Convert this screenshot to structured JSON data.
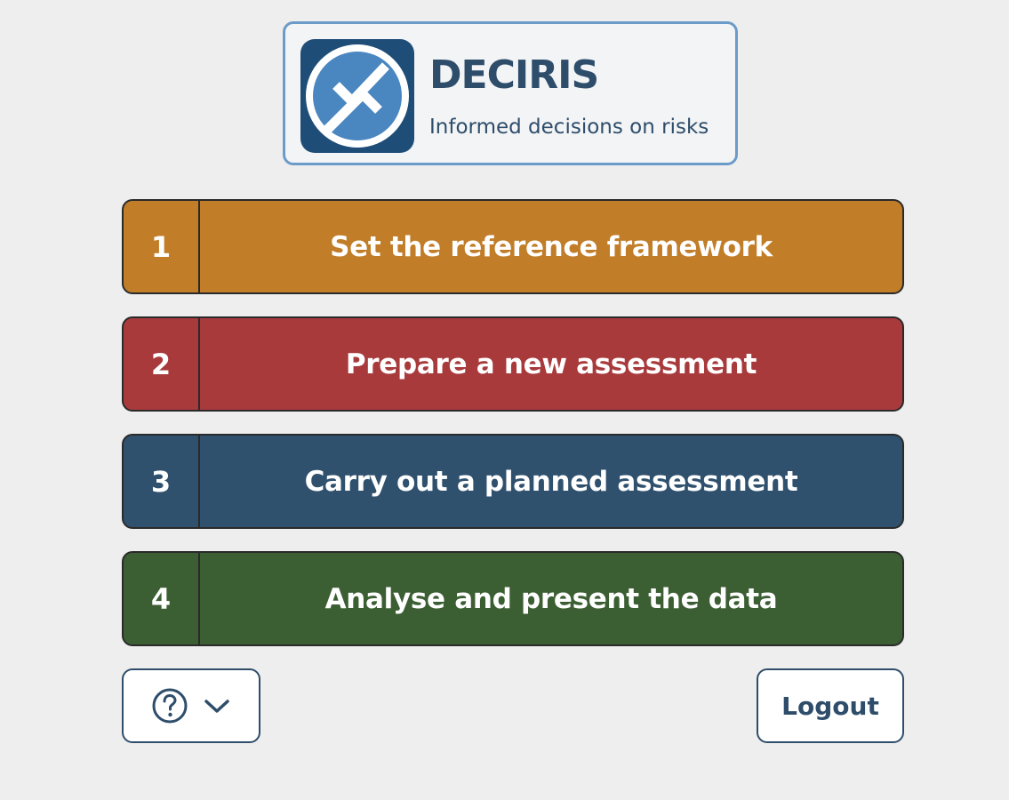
{
  "brand": {
    "name": "DECIRIS",
    "tagline": "Informed decisions on risks",
    "logo_icon": "deciris-logo-icon",
    "colors": {
      "primary": "#2e4d6b",
      "logo_bg": "#1e4d78",
      "logo_accent": "#4a86c0",
      "border": "#6b9bc9"
    }
  },
  "steps": [
    {
      "number": "1",
      "label": "Set the reference framework",
      "color": "#c17d28"
    },
    {
      "number": "2",
      "label": "Prepare a new assessment",
      "color": "#a83a3c"
    },
    {
      "number": "3",
      "label": "Carry out a planned assessment",
      "color": "#2f516e"
    },
    {
      "number": "4",
      "label": "Analyse and present the data",
      "color": "#3c5e33"
    }
  ],
  "footer": {
    "help_icon": "question-circle-icon",
    "dropdown_icon": "chevron-down-icon",
    "logout_label": "Logout"
  }
}
